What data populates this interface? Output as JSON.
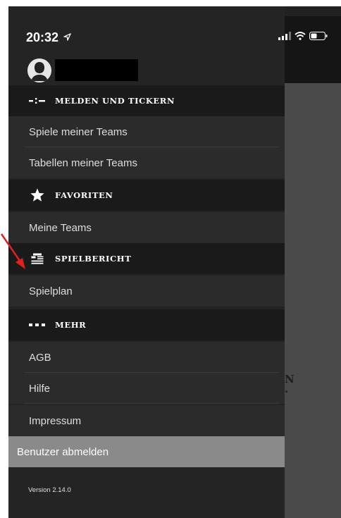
{
  "status_bar": {
    "time": "20:32"
  },
  "menu": {
    "sections": [
      {
        "id": "melden",
        "title": "MELDEN UND TICKERN",
        "icon": "ticker-icon",
        "items": [
          "Spiele meiner Teams",
          "Tabellen meiner Teams"
        ]
      },
      {
        "id": "favoriten",
        "title": "FAVORITEN",
        "icon": "star-icon",
        "items": [
          "Meine Teams"
        ]
      },
      {
        "id": "spielbericht",
        "title": "SPIELBERICHT",
        "icon": "report-icon",
        "items": [
          "Spielplan"
        ]
      },
      {
        "id": "mehr",
        "title": "MEHR",
        "icon": "more-icon",
        "items": [
          "AGB",
          "Hilfe",
          "Impressum"
        ]
      }
    ],
    "logout_label": "Benutzer abmelden",
    "version": "Version 2.14.0"
  },
  "background_text": {
    "line1": "​N",
    "line2": "."
  },
  "colors": {
    "drawer": "#242424",
    "section": "#1a1a1a",
    "item": "#2b2b2b",
    "logout": "#8a8a8a",
    "annotation_arrow": "#e0201b"
  }
}
